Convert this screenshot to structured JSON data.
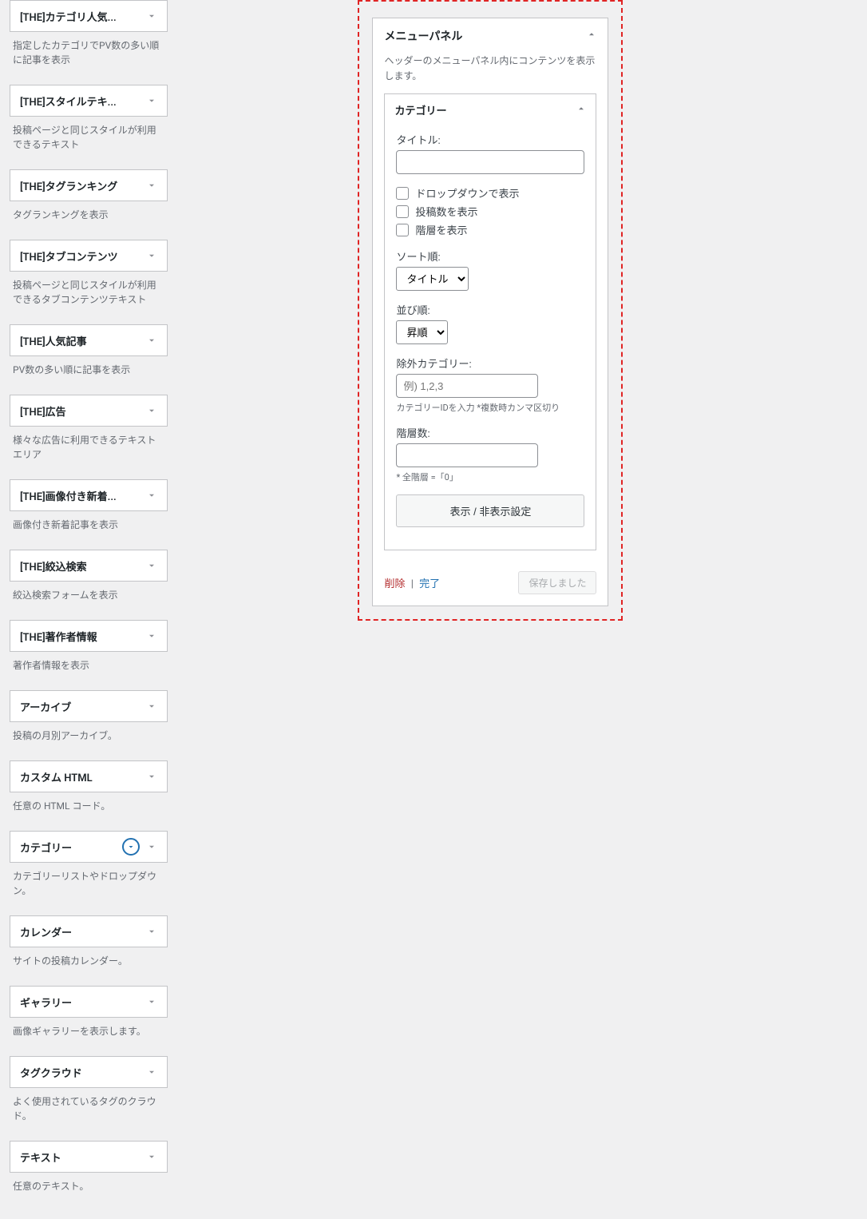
{
  "available_widgets": [
    {
      "title": "[THE]カテゴリ人気...",
      "desc": "指定したカテゴリでPV数の多い順に記事を表示"
    },
    {
      "title": "[THE]スタイルテキ...",
      "desc": "投稿ページと同じスタイルが利用できるテキスト"
    },
    {
      "title": "[THE]タグランキング",
      "desc": "タグランキングを表示"
    },
    {
      "title": "[THE]タブコンテンツ",
      "desc": "投稿ページと同じスタイルが利用できるタブコンテンツテキスト"
    },
    {
      "title": "[THE]人気記事",
      "desc": "PV数の多い順に記事を表示"
    },
    {
      "title": "[THE]広告",
      "desc": "様々な広告に利用できるテキストエリア"
    },
    {
      "title": "[THE]画像付き新着...",
      "desc": "画像付き新着記事を表示"
    },
    {
      "title": "[THE]絞込検索",
      "desc": "絞込検索フォームを表示"
    },
    {
      "title": "[THE]著作者情報",
      "desc": "著作者情報を表示"
    },
    {
      "title": "アーカイブ",
      "desc": "投稿の月別アーカイブ。"
    },
    {
      "title": "カスタム HTML",
      "desc": "任意の HTML コード。"
    },
    {
      "title": "カテゴリー",
      "desc": "カテゴリーリストやドロップダウン。",
      "legacy": true
    },
    {
      "title": "カレンダー",
      "desc": "サイトの投稿カレンダー。"
    },
    {
      "title": "ギャラリー",
      "desc": "画像ギャラリーを表示します。"
    },
    {
      "title": "タグクラウド",
      "desc": "よく使用されているタグのクラウド。"
    },
    {
      "title": "テキスト",
      "desc": "任意のテキスト。"
    }
  ],
  "panel": {
    "title": "メニューパネル",
    "desc": "ヘッダーのメニューパネル内にコンテンツを表示します。",
    "inner_widget_title": "カテゴリー",
    "form": {
      "title_label": "タイトル:",
      "cb_dropdown": "ドロップダウンで表示",
      "cb_count": "投稿数を表示",
      "cb_hier": "階層を表示",
      "sort_label": "ソート順:",
      "sort_value": "タイトル",
      "order_label": "並び順:",
      "order_value": "昇順",
      "exclude_label": "除外カテゴリー:",
      "exclude_placeholder": "例) 1,2,3",
      "exclude_hint": "カテゴリーIDを入力 *複数時カンマ区切り",
      "depth_label": "階層数:",
      "depth_hint": "* 全階層 =「0」",
      "display_toggle": "表示 / 非表示設定"
    },
    "actions": {
      "delete": "削除",
      "close": "完了",
      "saved": "保存しました"
    }
  }
}
